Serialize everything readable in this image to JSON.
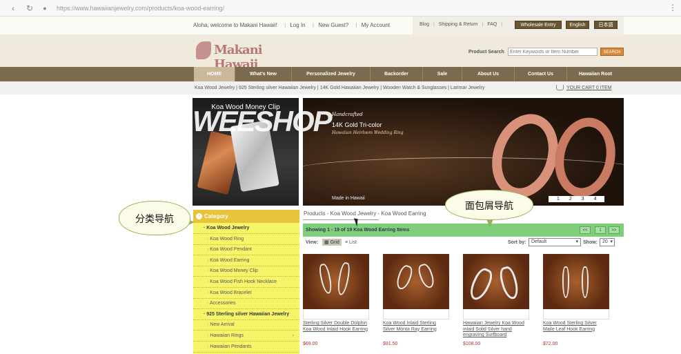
{
  "browser": {
    "url": "https://www.hawaiianjewelry.com/products/koa-wood-earring/"
  },
  "top_bar": {
    "welcome": "Aloha, welcome to Makani Hawaii!",
    "login": "Log In",
    "new_guest": "New Guest?",
    "my_account": "My Account",
    "links": [
      "Blog",
      "Shipping & Return",
      "FAQ"
    ],
    "wholesale": "Wholesale Entry",
    "english": "English",
    "japanese": "日本語"
  },
  "header": {
    "logo": "Makani Hawaii",
    "search_label": "Product Search",
    "search_placeholder": "Enter Keywords or Item Number",
    "search_button": "SEARCH"
  },
  "nav": {
    "items": [
      "HOME",
      "What's New",
      "Personalized Jewelry",
      "Backorder",
      "Sale",
      "About Us",
      "Contact Us",
      "Hawaiian Root"
    ]
  },
  "subnav": {
    "categories": "Koa Wood Jewelry | 925 Sterling silver Hawaiian Jewelry | 14K Gold Hawaiian Jewelry | Wooden Watch & Sunglasses | Larimar Jewelry",
    "cart": "YOUR CART 0 ITEM"
  },
  "promo": {
    "title": "Koa Wood Money Clip"
  },
  "banner": {
    "line1": "Handcrafted",
    "line2": "14K Gold Tri-color",
    "line3": "Hawaiian Heirloom Wedding Ring",
    "made_in": "Made in Hawaii",
    "slides": [
      "1",
      "2",
      "3",
      "4"
    ]
  },
  "watermark": "WEESHOP",
  "breadcrumb": "Products - Koa Wood Jewelry - Koa Wood Earring",
  "annotations": {
    "category_nav": "分类导航",
    "breadcrumb_nav": "面包屑导航"
  },
  "category": {
    "header": "Category",
    "items": [
      {
        "label": "Koa Wood Jewelry",
        "top": true
      },
      {
        "label": "Koa Wood Ring",
        "top": false
      },
      {
        "label": "Koa Wood Pendant",
        "top": false
      },
      {
        "label": "Koa Wood Earring",
        "top": false
      },
      {
        "label": "Koa Wood Money Clip",
        "top": false
      },
      {
        "label": "Koa Wood Fish Hook Necklace",
        "top": false
      },
      {
        "label": "Koa Wood Bracelet",
        "top": false
      },
      {
        "label": "Accessories",
        "top": false
      },
      {
        "label": "925 Sterling silver Hawaiian Jewelry",
        "top": true
      },
      {
        "label": "New Arrival",
        "top": false
      },
      {
        "label": "Hawaiian Rings",
        "top": false
      },
      {
        "label": "Hawaiian Pendants",
        "top": false
      }
    ]
  },
  "listing": {
    "showing": "Showing 1 - 19 of 19 Koa Wood Earring Items",
    "pager": [
      "<<",
      "1",
      ">>"
    ],
    "view_label": "View:",
    "grid": "Grid",
    "list": "List",
    "sort_label": "Sort by:",
    "sort_value": "Default",
    "show_label": "Show:",
    "show_value": "20"
  },
  "products": [
    {
      "name": "Sterling Silver Double Dolphin Koa Wood Inlaid Hook Earring",
      "price": "$69.00"
    },
    {
      "name": "Koa Wood Inlaid Sterling Silver Monta Ray Earring",
      "price": "$91.50"
    },
    {
      "name": "Hawaiian Jewelry Koa Wood inlaid Solid Silver hand engraving Surfboard",
      "price": "$108.00"
    },
    {
      "name": "Koa Wood Sterling Silver Maile Leaf Hook Earring",
      "price": "$72.00"
    }
  ],
  "colors": {
    "nav": "#7a6a4f",
    "category_header": "#e8c43c",
    "category_bg": "#f6f56a",
    "show_bar": "#7fcf7a",
    "price": "#aa3333"
  }
}
